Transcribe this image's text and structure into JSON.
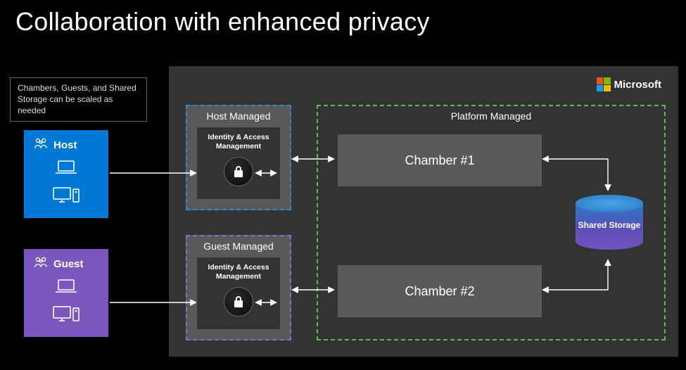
{
  "title": "Collaboration with enhanced privacy",
  "note": "Chambers, Guests, and Shared Storage can be scaled as needed",
  "brand": "Microsoft",
  "parties": {
    "host": {
      "label": "Host"
    },
    "guest": {
      "label": "Guest"
    }
  },
  "managed": {
    "host": {
      "title": "Host Managed",
      "iam": "Identity & Access Management"
    },
    "guest": {
      "title": "Guest Managed",
      "iam": "Identity & Access Management"
    }
  },
  "platform": {
    "title": "Platform Managed",
    "chamber1": "Chamber #1",
    "chamber2": "Chamber #2",
    "storage": "Shared Storage"
  }
}
